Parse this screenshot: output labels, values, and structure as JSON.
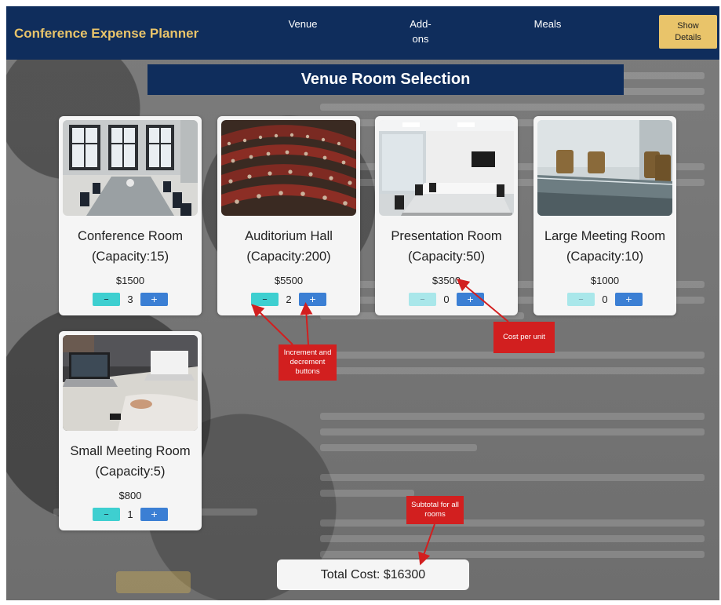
{
  "navbar": {
    "brand": "Conference Expense Planner",
    "links": [
      "Venue",
      "Add-\nons",
      "Meals"
    ],
    "show_details": "Show\nDetails"
  },
  "section_title": "Venue Room Selection",
  "rooms": [
    {
      "name": "Conference Room",
      "capacity": "(Capacity:15)",
      "price": "$1500",
      "quantity": "3",
      "decrement_label": "–",
      "increment_label": "+",
      "image_icon": "conference-room-photo"
    },
    {
      "name": "Auditorium Hall",
      "capacity": "(Capacity:200)",
      "price": "$5500",
      "quantity": "2",
      "decrement_label": "–",
      "increment_label": "+",
      "image_icon": "auditorium-photo"
    },
    {
      "name": "Presentation Room",
      "capacity": "(Capacity:50)",
      "price": "$3500",
      "quantity": "0",
      "decrement_label": "–",
      "increment_label": "+",
      "image_icon": "presentation-room-photo"
    },
    {
      "name": "Large Meeting Room",
      "capacity": "(Capacity:10)",
      "price": "$1000",
      "quantity": "0",
      "decrement_label": "–",
      "increment_label": "+",
      "image_icon": "large-meeting-room-photo"
    },
    {
      "name": "Small Meeting Room",
      "capacity": "(Capacity:5)",
      "price": "$800",
      "quantity": "1",
      "decrement_label": "–",
      "increment_label": "+",
      "image_icon": "small-meeting-room-photo"
    }
  ],
  "total": "Total Cost: $16300",
  "annotations": {
    "stepper": "Increment and decrement buttons",
    "cost": "Cost per unit",
    "subtotal": "Subtotal for all rooms"
  },
  "colors": {
    "navy": "#0f2d5c",
    "gold": "#e9c46a",
    "decrement": "#3ecfd0",
    "increment": "#3b7fd4",
    "annotation": "#d21f1f"
  }
}
